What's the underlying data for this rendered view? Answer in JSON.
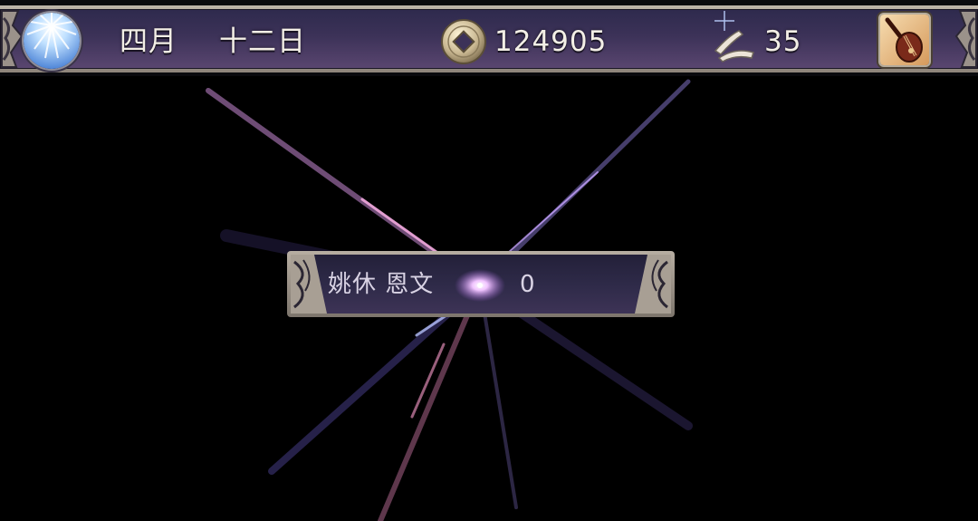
{
  "top_bar": {
    "month": "四月",
    "day": "十二日",
    "coins": "124905",
    "tickets": "35"
  },
  "banner": {
    "name": "姚休 恩文",
    "value": "0"
  },
  "colors": {
    "bar_purple": "#3c3258",
    "frame_silver": "#b7aea2",
    "text": "#f3efe6",
    "flare_pink": "#e7a6d6",
    "flare_blue": "#a7b4ff"
  },
  "icons": {
    "weather": "sun-icon",
    "currency": "coin-icon",
    "tickets": "ticket-icon",
    "instrument": "pipa-icon"
  }
}
